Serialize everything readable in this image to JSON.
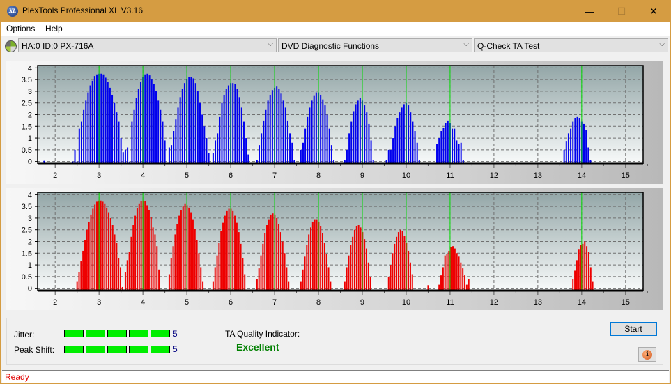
{
  "window": {
    "title": "PlexTools Professional XL V3.16",
    "app_icon_text": "XL",
    "controls": {
      "minimize": "—",
      "maximize": "☐",
      "close": "✕"
    }
  },
  "menu": {
    "items": [
      "Options",
      "Help"
    ]
  },
  "toolbar": {
    "drive": "HA:0 ID:0  PX-716A",
    "function_group": "DVD Diagnostic Functions",
    "test": "Q-Check TA Test",
    "chevron": "⌵"
  },
  "colors": {
    "top_bars": "#0000ee",
    "bottom_bars": "#ee0000",
    "marker_lines": "#00dd00",
    "meter_fill": "#00ee00",
    "quality_text": "#008000",
    "status_text": "#e00000"
  },
  "chart_data": [
    {
      "type": "bar",
      "name": "top-chart (blue)",
      "xlim": [
        1.6,
        15.4
      ],
      "ylim": [
        -0.1,
        4.1
      ],
      "x_ticks": [
        2,
        3,
        4,
        5,
        6,
        7,
        8,
        9,
        10,
        11,
        12,
        13,
        14,
        15
      ],
      "y_ticks": [
        0,
        0.5,
        1,
        1.5,
        2,
        2.5,
        3,
        3.5,
        4
      ],
      "y_tick_labels": [
        "0",
        "0.5",
        "1",
        "1.5",
        "2",
        "2.5",
        "3",
        "3.5",
        "4"
      ],
      "markers": [
        3,
        4,
        5,
        6,
        7,
        8,
        9,
        10,
        11,
        14
      ],
      "grid": true,
      "peaks": [
        {
          "center": 2.95,
          "start": 2.4,
          "step": 0.05,
          "values": [
            0,
            0.5,
            0,
            1.4,
            1.7,
            2.2,
            2.6,
            2.95,
            3.25,
            3.45,
            3.65,
            3.72,
            3.75,
            3.75,
            3.72,
            3.58,
            3.4,
            3.15,
            2.85,
            2.5,
            2.1,
            1.7,
            1.0,
            0.4,
            0.05
          ]
        },
        {
          "center": 4.0,
          "start": 3.6,
          "step": 0.05,
          "values": [
            0.5,
            0.6,
            0,
            1.7,
            2.2,
            2.7,
            3.1,
            3.4,
            3.6,
            3.72,
            3.75,
            3.68,
            3.5,
            3.3,
            3.0,
            2.6,
            2.2,
            1.7,
            0.9
          ]
        },
        {
          "center": 5.0,
          "start": 4.6,
          "step": 0.05,
          "values": [
            0.6,
            0.7,
            1.3,
            1.8,
            2.3,
            2.75,
            3.1,
            3.35,
            3.53,
            3.6,
            3.6,
            3.55,
            3.35,
            3.0,
            2.5,
            2.0,
            1.5,
            1.0,
            0.35
          ]
        },
        {
          "center": 6.0,
          "start": 5.6,
          "step": 0.05,
          "values": [
            0.35,
            0.9,
            1.2,
            1.9,
            2.5,
            2.85,
            3.1,
            3.25,
            3.35,
            3.35,
            3.3,
            3.1,
            2.75,
            2.3,
            1.7,
            1.0,
            0.3
          ]
        },
        {
          "center": 7.0,
          "start": 6.6,
          "step": 0.05,
          "values": [
            0.05,
            0.7,
            1.2,
            1.75,
            2.2,
            2.6,
            2.85,
            3.05,
            3.15,
            3.2,
            3.1,
            2.9,
            2.6,
            2.3,
            1.75,
            1.2,
            0.8,
            0.05
          ]
        },
        {
          "center": 8.0,
          "start": 7.6,
          "step": 0.05,
          "values": [
            0.5,
            0.8,
            1.4,
            1.9,
            2.3,
            2.6,
            2.8,
            2.95,
            2.95,
            2.85,
            2.65,
            2.4,
            2.0,
            1.4,
            0.7,
            0.05
          ]
        },
        {
          "center": 9.0,
          "start": 8.6,
          "step": 0.05,
          "values": [
            0.05,
            0.5,
            1.2,
            1.7,
            2.15,
            2.45,
            2.6,
            2.7,
            2.6,
            2.4,
            2.1,
            1.6,
            0.9,
            0.05
          ]
        },
        {
          "center": 10.0,
          "start": 9.55,
          "step": 0.05,
          "values": [
            0.05,
            0.5,
            0.5,
            1.0,
            1.5,
            1.85,
            2.1,
            2.3,
            2.45,
            2.5,
            2.4,
            2.1,
            1.7,
            1.3,
            0.8,
            0.05
          ]
        },
        {
          "center": 11.0,
          "start": 10.7,
          "step": 0.05,
          "values": [
            0.75,
            1.0,
            1.3,
            1.45,
            1.65,
            1.75,
            1.65,
            1.4,
            1.4,
            0.9,
            0.75,
            0.8,
            0.05
          ]
        },
        {
          "center": 14.0,
          "start": 13.6,
          "step": 0.05,
          "values": [
            0.5,
            0.85,
            1.2,
            1.4,
            1.7,
            1.85,
            1.9,
            1.85,
            1.7,
            1.6,
            1.35,
            0.6,
            0.05
          ]
        }
      ],
      "outliers": [
        [
          1.75,
          0.0
        ]
      ]
    },
    {
      "type": "bar",
      "name": "bottom-chart (red)",
      "xlim": [
        1.6,
        15.4
      ],
      "ylim": [
        -0.1,
        4.1
      ],
      "x_ticks": [
        2,
        3,
        4,
        5,
        6,
        7,
        8,
        9,
        10,
        11,
        12,
        13,
        14,
        15
      ],
      "y_ticks": [
        0,
        0.5,
        1,
        1.5,
        2,
        2.5,
        3,
        3.5,
        4
      ],
      "y_tick_labels": [
        "0",
        "0.5",
        "1",
        "1.5",
        "2",
        "2.5",
        "3",
        "3.5",
        "4"
      ],
      "markers": [
        3,
        4,
        5,
        6,
        7,
        8,
        9,
        10,
        11,
        14
      ],
      "grid": true,
      "peaks": [
        {
          "center": 3.0,
          "start": 2.5,
          "step": 0.045,
          "values": [
            0.3,
            0.7,
            1.15,
            1.6,
            2.05,
            2.5,
            2.85,
            3.15,
            3.4,
            3.58,
            3.7,
            3.75,
            3.75,
            3.7,
            3.6,
            3.45,
            3.25,
            3.0,
            2.7,
            2.3,
            1.95,
            1.3,
            0.9,
            0.05
          ]
        },
        {
          "center": 4.0,
          "start": 3.6,
          "step": 0.045,
          "values": [
            0.7,
            1.2,
            1.55,
            2.2,
            2.7,
            3.1,
            3.42,
            3.6,
            3.72,
            3.75,
            3.72,
            3.55,
            3.35,
            3.05,
            2.6,
            2.3,
            1.8,
            0.8
          ]
        },
        {
          "center": 5.0,
          "start": 4.6,
          "step": 0.045,
          "values": [
            0.6,
            1.3,
            1.8,
            2.3,
            2.75,
            3.1,
            3.35,
            3.5,
            3.6,
            3.55,
            3.45,
            3.25,
            2.95,
            2.55,
            2.05,
            1.5,
            0.9,
            0.3
          ]
        },
        {
          "center": 6.0,
          "start": 5.6,
          "step": 0.045,
          "values": [
            0.3,
            0.9,
            1.4,
            1.95,
            2.45,
            2.8,
            3.1,
            3.3,
            3.4,
            3.4,
            3.3,
            3.1,
            2.8,
            2.4,
            1.9,
            1.3,
            0.6
          ]
        },
        {
          "center": 7.0,
          "start": 6.6,
          "step": 0.045,
          "values": [
            0.4,
            0.85,
            1.4,
            1.9,
            2.35,
            2.7,
            2.95,
            3.15,
            3.2,
            3.15,
            3.0,
            2.75,
            2.4,
            2.0,
            1.5,
            0.9,
            0.3
          ]
        },
        {
          "center": 8.0,
          "start": 7.6,
          "step": 0.045,
          "values": [
            0.3,
            0.8,
            1.35,
            1.85,
            2.3,
            2.6,
            2.85,
            2.95,
            2.95,
            2.85,
            2.65,
            2.35,
            1.95,
            1.45,
            0.9,
            0.3
          ]
        },
        {
          "center": 9.0,
          "start": 8.6,
          "step": 0.045,
          "values": [
            0.3,
            0.9,
            1.4,
            1.85,
            2.2,
            2.5,
            2.65,
            2.7,
            2.6,
            2.4,
            2.1,
            1.7,
            1.1,
            0.5
          ]
        },
        {
          "center": 10.0,
          "start": 9.6,
          "step": 0.045,
          "values": [
            0.5,
            1.0,
            1.5,
            1.9,
            2.2,
            2.4,
            2.5,
            2.45,
            2.25,
            1.95,
            1.6,
            1.1,
            0.6
          ]
        },
        {
          "center": 11.0,
          "start": 10.75,
          "step": 0.045,
          "values": [
            0.15,
            0.55,
            0.9,
            1.4,
            1.45,
            1.6,
            1.75,
            1.8,
            1.7,
            1.5,
            1.35,
            1.1,
            0.85,
            0.55,
            0.15,
            0.4
          ]
        },
        {
          "center": 14.0,
          "start": 13.8,
          "step": 0.045,
          "values": [
            0.4,
            0.75,
            1.2,
            1.65,
            1.85,
            1.9,
            2.0,
            1.8,
            1.55,
            0.9,
            0.3
          ]
        }
      ],
      "outliers": [
        [
          10.5,
          0.1
        ]
      ]
    }
  ],
  "results": {
    "jitter_label": "Jitter:",
    "jitter_value": "5",
    "jitter_segments": 5,
    "peak_shift_label": "Peak Shift:",
    "peak_shift_value": "5",
    "peak_shift_segments": 5,
    "ta_quality_label": "TA Quality Indicator:",
    "ta_quality_value": "Excellent"
  },
  "buttons": {
    "start": "Start",
    "info": "i"
  },
  "status": {
    "text": "Ready"
  }
}
